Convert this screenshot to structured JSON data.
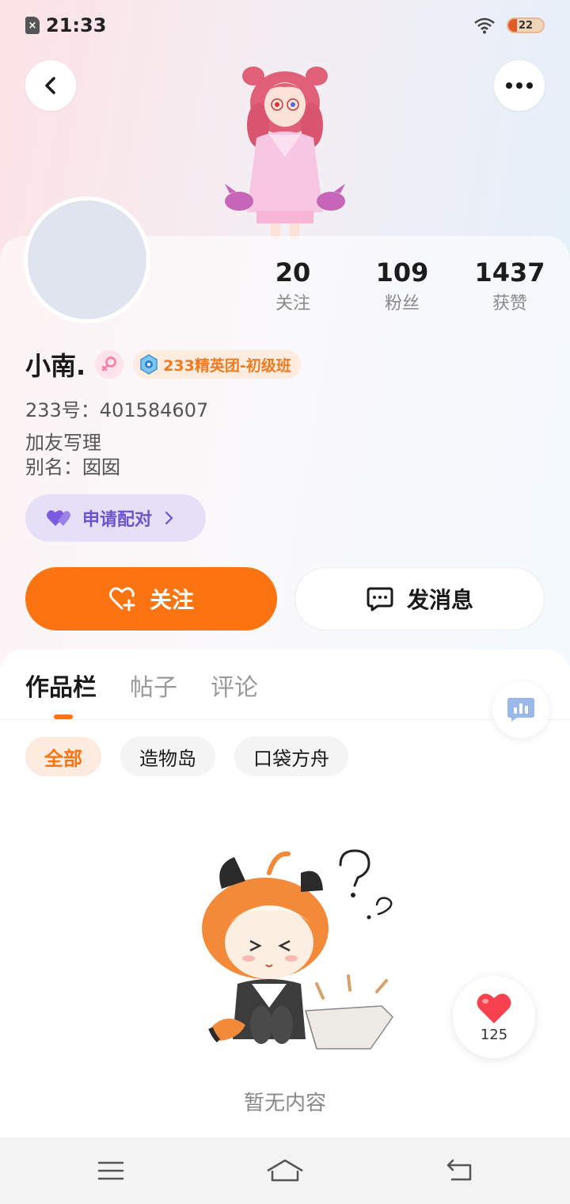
{
  "status_bar": {
    "time": "21:33",
    "battery_level": "22",
    "icons": [
      "sim-off-icon",
      "wifi-icon",
      "battery-icon"
    ]
  },
  "profile": {
    "username": "小南.",
    "gender": "female",
    "level_badge": "233精英团-初级班",
    "uid_text": "233号：401584607",
    "bio_line1": "加友写理",
    "bio_line2": "别名：囡囡",
    "pair_button": "申请配对"
  },
  "stats": [
    {
      "value": "20",
      "label": "关注"
    },
    {
      "value": "109",
      "label": "粉丝"
    },
    {
      "value": "1437",
      "label": "获赞"
    }
  ],
  "actions": {
    "follow": "关注",
    "message": "发消息"
  },
  "tabs": [
    {
      "label": "作品栏",
      "active": true
    },
    {
      "label": "帖子",
      "active": false
    },
    {
      "label": "评论",
      "active": false
    }
  ],
  "filters": [
    {
      "label": "全部",
      "active": true
    },
    {
      "label": "造物岛",
      "active": false
    },
    {
      "label": "口袋方舟",
      "active": false
    }
  ],
  "empty_state": {
    "text": "暂无内容"
  },
  "like_float": {
    "count": "125"
  },
  "colors": {
    "accent": "#fb7411",
    "pair_purple": "#6a55cc",
    "gender_pink": "#ff7aa0"
  }
}
